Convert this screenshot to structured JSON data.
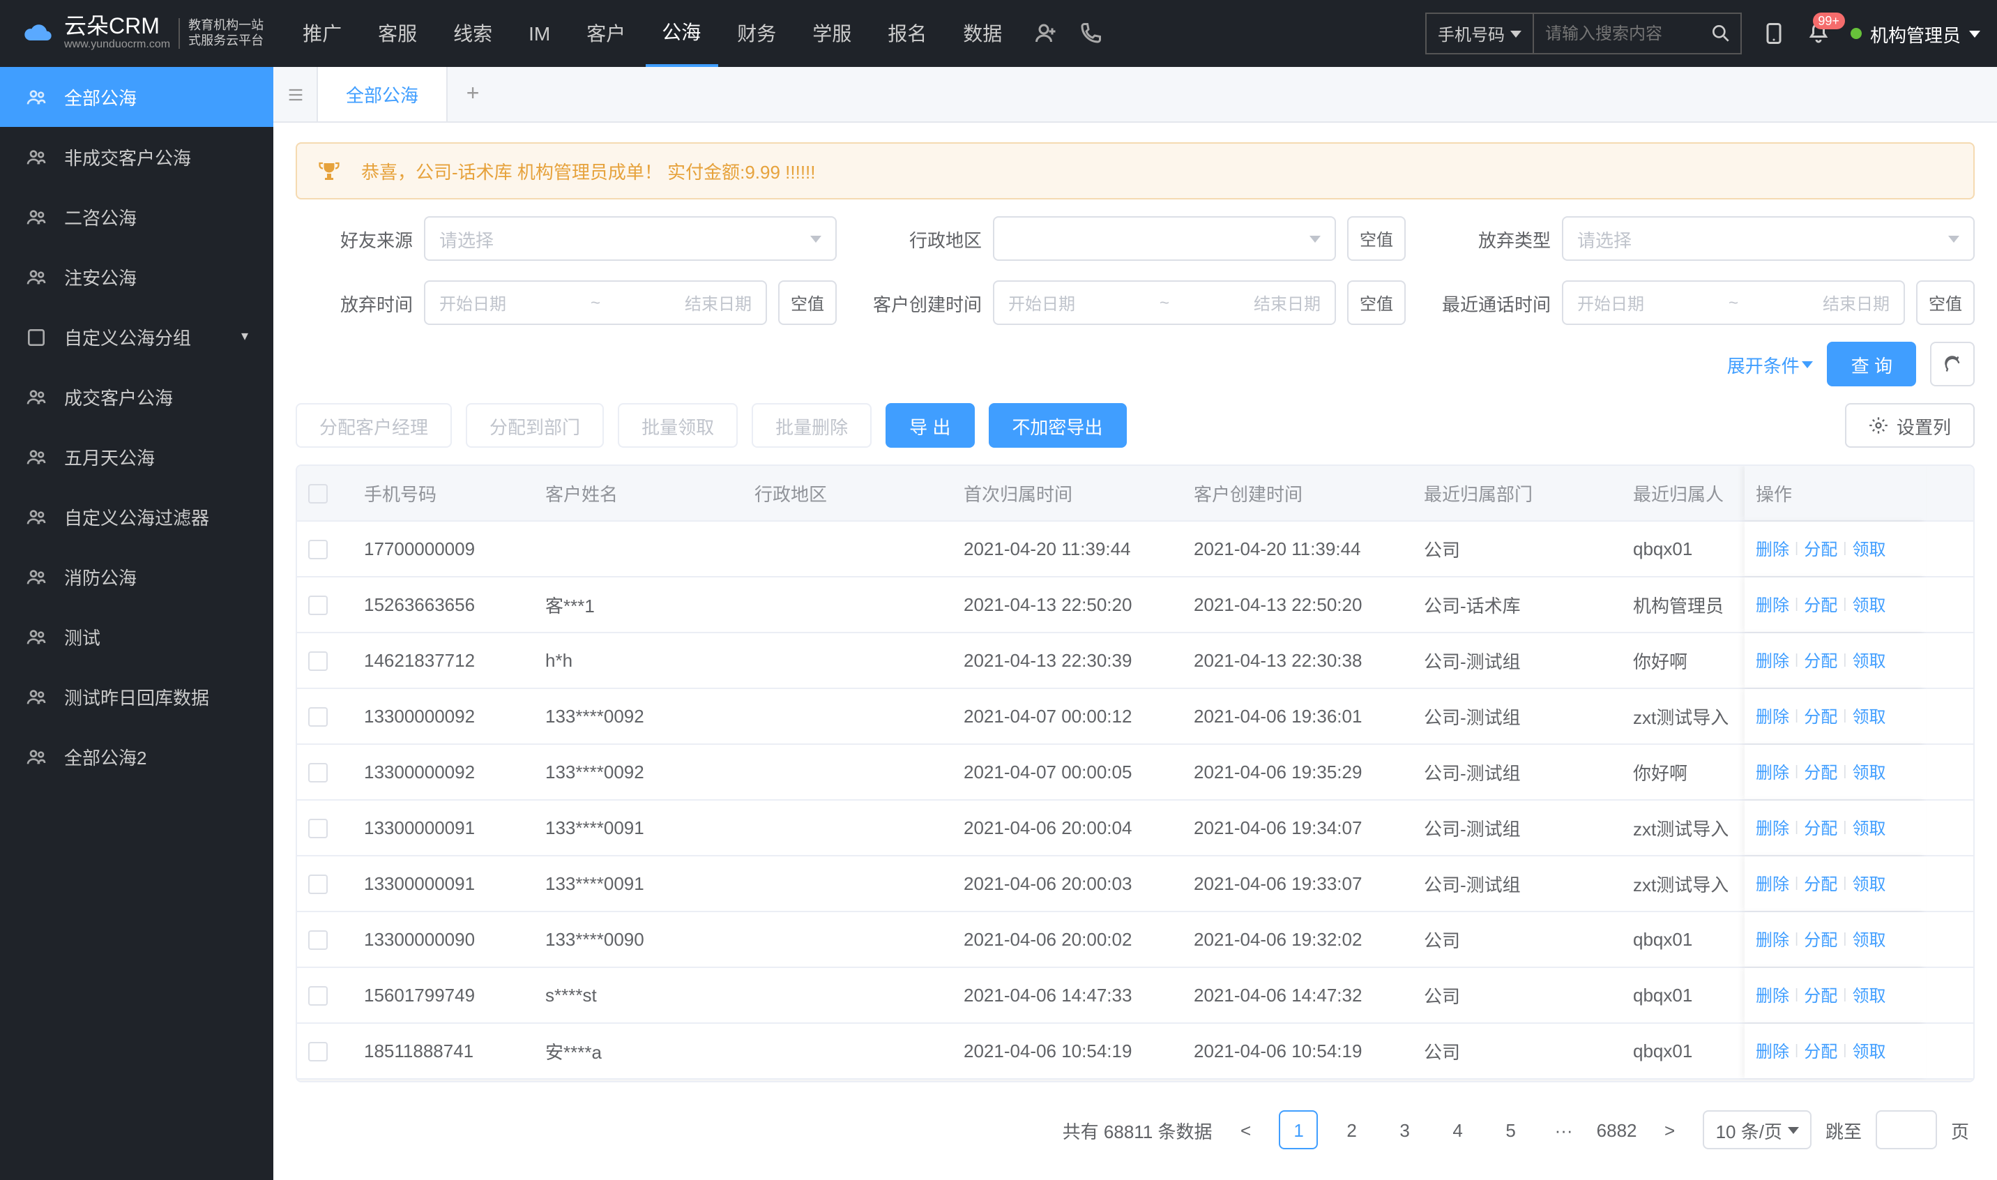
{
  "logo": {
    "title": "云朵CRM",
    "sub": "www.yunduocrm.com",
    "side1": "教育机构一站",
    "side2": "式服务云平台"
  },
  "topnav": {
    "items": [
      "推广",
      "客服",
      "线索",
      "IM",
      "客户",
      "公海",
      "财务",
      "学服",
      "报名",
      "数据"
    ],
    "active_index": 5,
    "search_type": "手机号码",
    "search_placeholder": "请输入搜索内容",
    "badge": "99+",
    "user": "机构管理员"
  },
  "sidebar": {
    "items": [
      {
        "label": "全部公海",
        "expandable": false
      },
      {
        "label": "非成交客户公海",
        "expandable": false
      },
      {
        "label": "二咨公海",
        "expandable": false
      },
      {
        "label": "注安公海",
        "expandable": false
      },
      {
        "label": "自定义公海分组",
        "expandable": true
      },
      {
        "label": "成交客户公海",
        "expandable": false
      },
      {
        "label": "五月天公海",
        "expandable": false
      },
      {
        "label": "自定义公海过滤器",
        "expandable": false
      },
      {
        "label": "消防公海",
        "expandable": false
      },
      {
        "label": "测试",
        "expandable": false
      },
      {
        "label": "测试昨日回库数据",
        "expandable": false
      },
      {
        "label": "全部公海2",
        "expandable": false
      }
    ],
    "active_index": 0
  },
  "tabs": {
    "items": [
      "全部公海"
    ],
    "active_index": 0
  },
  "alert": "恭喜，公司-话术库  机构管理员成单！  实付金额:9.99 !!!!!!",
  "filters": {
    "labels": {
      "source": "好友来源",
      "region": "行政地区",
      "abandon_type": "放弃类型",
      "abandon_time": "放弃时间",
      "create_time": "客户创建时间",
      "call_time": "最近通话时间"
    },
    "placeholder_select": "请选择",
    "placeholder_start": "开始日期",
    "placeholder_end": "结束日期",
    "null_btn": "空值",
    "expand": "展开条件",
    "query": "查 询"
  },
  "actions": {
    "assign_mgr": "分配客户经理",
    "assign_dept": "分配到部门",
    "batch_claim": "批量领取",
    "batch_delete": "批量删除",
    "export": "导 出",
    "export_plain": "不加密导出",
    "cols": "设置列"
  },
  "table": {
    "columns": [
      "手机号码",
      "客户姓名",
      "行政地区",
      "首次归属时间",
      "客户创建时间",
      "最近归属部门",
      "最近归属人",
      "操作"
    ],
    "ops": {
      "delete": "删除",
      "assign": "分配",
      "claim": "领取"
    },
    "rows": [
      {
        "phone": "17700000009",
        "name": "",
        "region": "",
        "first_time": "2021-04-20 11:39:44",
        "create_time": "2021-04-20 11:39:44",
        "dept": "公司",
        "owner": "qbqx01"
      },
      {
        "phone": "15263663656",
        "name": "客***1",
        "region": "",
        "first_time": "2021-04-13 22:50:20",
        "create_time": "2021-04-13 22:50:20",
        "dept": "公司-话术库",
        "owner": "机构管理员"
      },
      {
        "phone": "14621837712",
        "name": "h*h",
        "region": "",
        "first_time": "2021-04-13 22:30:39",
        "create_time": "2021-04-13 22:30:38",
        "dept": "公司-测试组",
        "owner": "你好啊"
      },
      {
        "phone": "13300000092",
        "name": "133****0092",
        "region": "",
        "first_time": "2021-04-07 00:00:12",
        "create_time": "2021-04-06 19:36:01",
        "dept": "公司-测试组",
        "owner": "zxt测试导入"
      },
      {
        "phone": "13300000092",
        "name": "133****0092",
        "region": "",
        "first_time": "2021-04-07 00:00:05",
        "create_time": "2021-04-06 19:35:29",
        "dept": "公司-测试组",
        "owner": "你好啊"
      },
      {
        "phone": "13300000091",
        "name": "133****0091",
        "region": "",
        "first_time": "2021-04-06 20:00:04",
        "create_time": "2021-04-06 19:34:07",
        "dept": "公司-测试组",
        "owner": "zxt测试导入"
      },
      {
        "phone": "13300000091",
        "name": "133****0091",
        "region": "",
        "first_time": "2021-04-06 20:00:03",
        "create_time": "2021-04-06 19:33:07",
        "dept": "公司-测试组",
        "owner": "zxt测试导入"
      },
      {
        "phone": "13300000090",
        "name": "133****0090",
        "region": "",
        "first_time": "2021-04-06 20:00:02",
        "create_time": "2021-04-06 19:32:02",
        "dept": "公司",
        "owner": "qbqx01"
      },
      {
        "phone": "15601799749",
        "name": "s****st",
        "region": "",
        "first_time": "2021-04-06 14:47:33",
        "create_time": "2021-04-06 14:47:32",
        "dept": "公司",
        "owner": "qbqx01"
      },
      {
        "phone": "18511888741",
        "name": "安****a",
        "region": "",
        "first_time": "2021-04-06 10:54:19",
        "create_time": "2021-04-06 10:54:19",
        "dept": "公司",
        "owner": "qbqx01"
      }
    ]
  },
  "pager": {
    "total_prefix": "共有",
    "total": "68811",
    "total_suffix": "条数据",
    "pages": [
      "1",
      "2",
      "3",
      "4",
      "5"
    ],
    "ellipsis": "···",
    "last": "6882",
    "per_page": "10 条/页",
    "jump_label": "跳至",
    "jump_value": "",
    "jump_suffix": "页"
  }
}
